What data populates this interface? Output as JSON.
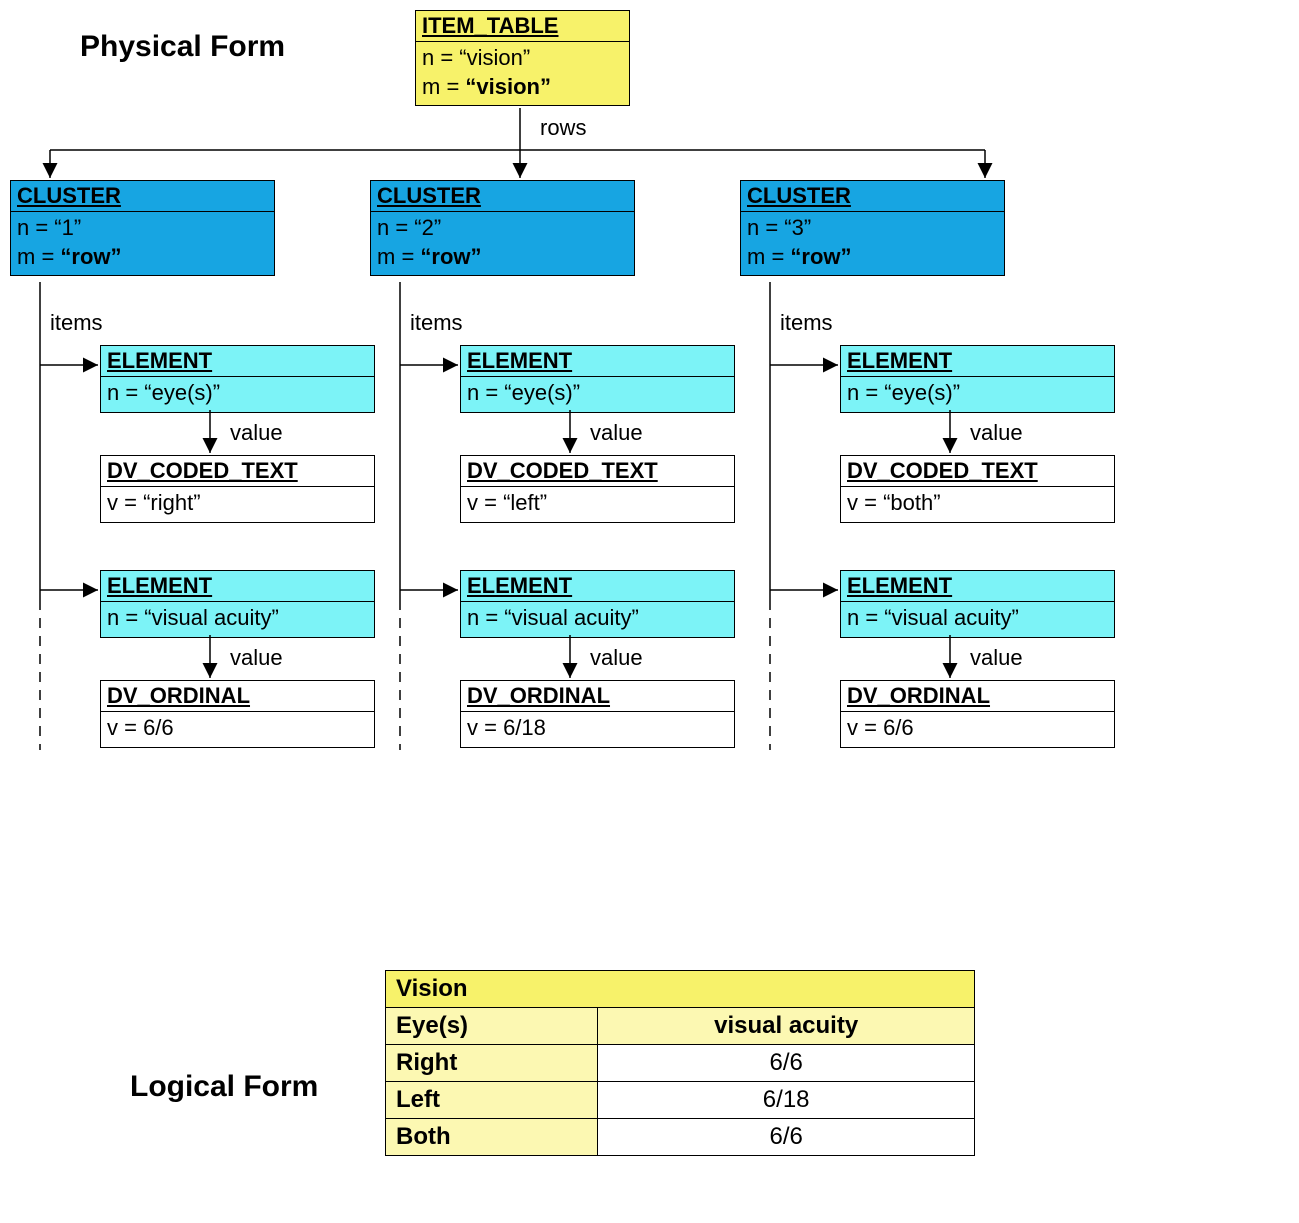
{
  "titles": {
    "physical": "Physical Form",
    "logical": "Logical Form"
  },
  "edge_labels": {
    "rows": "rows",
    "items": "items",
    "value": "value"
  },
  "root": {
    "type": "ITEM_TABLE",
    "n": "n = “vision”",
    "m_pre": "m = ",
    "m_val": "“vision”"
  },
  "clusters": [
    {
      "type": "CLUSTER",
      "n": "n = “1”",
      "m_pre": "m = ",
      "m_val": "“row”",
      "elems": [
        {
          "type": "ELEMENT",
          "n": "n = “eye(s)”",
          "value_type": "DV_CODED_TEXT",
          "v": "v = “right”"
        },
        {
          "type": "ELEMENT",
          "n": "n = “visual acuity”",
          "value_type": "DV_ORDINAL",
          "v": "v = 6/6"
        }
      ]
    },
    {
      "type": "CLUSTER",
      "n": "n = “2”",
      "m_pre": "m = ",
      "m_val": "“row”",
      "elems": [
        {
          "type": "ELEMENT",
          "n": "n = “eye(s)”",
          "value_type": "DV_CODED_TEXT",
          "v": "v = “left”"
        },
        {
          "type": "ELEMENT",
          "n": "n = “visual acuity”",
          "value_type": "DV_ORDINAL",
          "v": "v = 6/18"
        }
      ]
    },
    {
      "type": "CLUSTER",
      "n": "n = “3”",
      "m_pre": "m = ",
      "m_val": "“row”",
      "elems": [
        {
          "type": "ELEMENT",
          "n": "n = “eye(s)”",
          "value_type": "DV_CODED_TEXT",
          "v": "v = “both”"
        },
        {
          "type": "ELEMENT",
          "n": "n = “visual acuity”",
          "value_type": "DV_ORDINAL",
          "v": "v = 6/6"
        }
      ]
    }
  ],
  "logical": {
    "title": "Vision",
    "cols": [
      "Eye(s)",
      "visual acuity"
    ],
    "rows": [
      {
        "eye": "Right",
        "va": "6/6"
      },
      {
        "eye": "Left",
        "va": "6/18"
      },
      {
        "eye": "Both",
        "va": "6/6"
      }
    ]
  }
}
